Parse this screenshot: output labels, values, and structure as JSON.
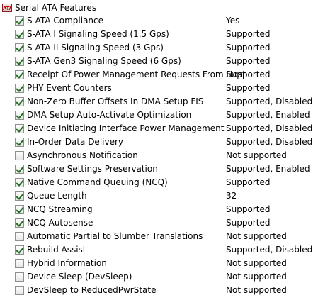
{
  "header": {
    "icon": "sata-chip-icon",
    "title": "Serial ATA Features"
  },
  "features": [
    {
      "label": "S-ATA Compliance",
      "value": "Yes",
      "checked": true
    },
    {
      "label": "S-ATA I Signaling Speed (1.5 Gps)",
      "value": "Supported",
      "checked": true
    },
    {
      "label": "S-ATA II Signaling Speed (3 Gps)",
      "value": "Supported",
      "checked": true
    },
    {
      "label": "S-ATA Gen3 Signaling Speed (6 Gps)",
      "value": "Supported",
      "checked": true
    },
    {
      "label": "Receipt Of Power Management Requests From Host",
      "value": "Supported",
      "checked": true
    },
    {
      "label": "PHY Event Counters",
      "value": "Supported",
      "checked": true
    },
    {
      "label": "Non-Zero Buffer Offsets In DMA Setup FIS",
      "value": "Supported, Disabled",
      "checked": true
    },
    {
      "label": "DMA Setup Auto-Activate Optimization",
      "value": "Supported, Enabled",
      "checked": true
    },
    {
      "label": "Device Initiating Interface Power Management",
      "value": "Supported, Disabled",
      "checked": true
    },
    {
      "label": "In-Order Data Delivery",
      "value": "Supported, Disabled",
      "checked": true
    },
    {
      "label": "Asynchronous Notification",
      "value": "Not supported",
      "checked": false
    },
    {
      "label": "Software Settings Preservation",
      "value": "Supported, Enabled",
      "checked": true
    },
    {
      "label": "Native Command Queuing (NCQ)",
      "value": "Supported",
      "checked": true
    },
    {
      "label": "Queue Length",
      "value": "32",
      "checked": true
    },
    {
      "label": "NCQ Streaming",
      "value": "Supported",
      "checked": true
    },
    {
      "label": "NCQ Autosense",
      "value": "Supported",
      "checked": true
    },
    {
      "label": "Automatic Partial to Slumber Translations",
      "value": "Not supported",
      "checked": false
    },
    {
      "label": "Rebuild Assist",
      "value": "Supported, Disabled",
      "checked": true
    },
    {
      "label": "Hybrid Information",
      "value": "Not supported",
      "checked": false
    },
    {
      "label": "Device Sleep (DevSleep)",
      "value": "Not supported",
      "checked": false
    },
    {
      "label": "DevSleep to ReducedPwrState",
      "value": "Not supported",
      "checked": false
    }
  ]
}
